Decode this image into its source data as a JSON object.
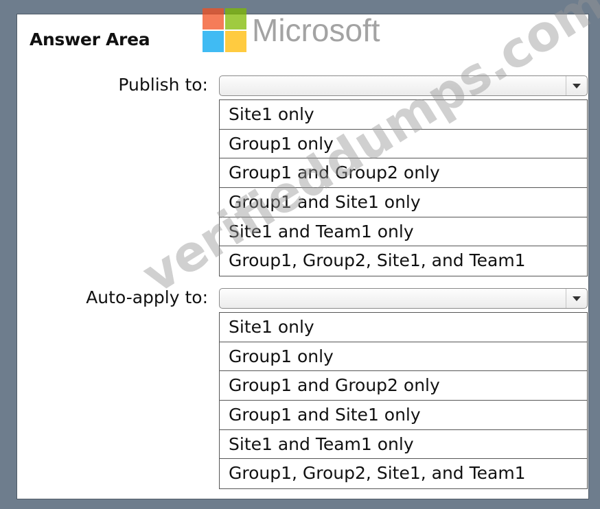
{
  "header": {
    "title": "Answer Area",
    "logo_text": "Microsoft",
    "logo_colors": [
      "#f25022",
      "#7fba00",
      "#00a4ef",
      "#ffb900"
    ]
  },
  "publish": {
    "label": "Publish to:",
    "selected": "",
    "options": [
      "Site1 only",
      "Group1 only",
      "Group1 and Group2 only",
      "Group1 and Site1 only",
      "Site1 and Team1 only",
      "Group1, Group2, Site1, and Team1"
    ]
  },
  "auto_apply": {
    "label": "Auto-apply to:",
    "selected": "",
    "options": [
      "Site1 only",
      "Group1 only",
      "Group1 and Group2 only",
      "Group1 and Site1 only",
      "Site1 and Team1 only",
      "Group1, Group2, Site1, and Team1"
    ]
  },
  "watermark": "verifieddumps.com"
}
